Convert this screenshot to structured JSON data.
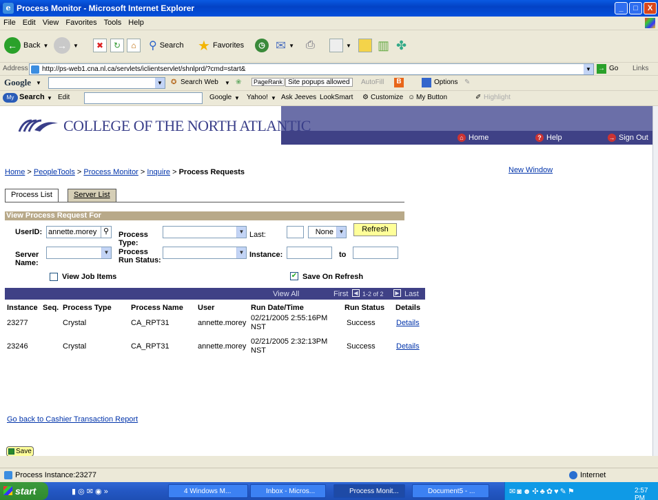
{
  "window": {
    "title": "Process Monitor - Microsoft Internet Explorer",
    "minimize": "_",
    "maximize": "□",
    "close": "X"
  },
  "menu": [
    "File",
    "Edit",
    "View",
    "Favorites",
    "Tools",
    "Help"
  ],
  "toolbar": {
    "back": "Back",
    "search": "Search",
    "favorites": "Favorites"
  },
  "address": {
    "label": "Address",
    "url": "http://ps-web1.cna.nl.ca/servlets/iclientservlet/shnlprd/?cmd=start&",
    "go": "Go",
    "links": "Links"
  },
  "googlebar": {
    "brand": "Google",
    "search_web": "Search Web",
    "pagerank": "PageRank",
    "popups": "Site popups allowed",
    "autofill": "AutoFill",
    "options": "Options"
  },
  "yahoobar": {
    "brand": "Search",
    "edit": "Edit",
    "google": "Google",
    "yahoo": "Yahoo!",
    "askjeeves": "Ask Jeeves",
    "looksmart": "LookSmart",
    "customize": "Customize",
    "mybutton": "My Button",
    "highlight": "Highlight"
  },
  "banner": {
    "college": "COLLEGE OF THE NORTH ATLANTIC",
    "home": "Home",
    "help": "Help",
    "signout": "Sign Out"
  },
  "breadcrumb": {
    "home": "Home",
    "peopletools": "PeopleTools",
    "process_monitor": "Process Monitor",
    "inquire": "Inquire",
    "sep": " > ",
    "current": "Process Requests"
  },
  "new_window": "New Window",
  "tabs": {
    "process_list": "Process List",
    "server_list": "Server List"
  },
  "section_title": "View Process Request For",
  "form": {
    "userid_label": "UserID:",
    "userid_value": "annette.morey",
    "process_type_label": "Process Type:",
    "last_label": "Last:",
    "last_value": "",
    "last_unit": "None",
    "refresh": "Refresh",
    "server_label": "Server Name:",
    "run_status_label": "Process Run Status:",
    "instance_label": "Instance:",
    "instance_from": "",
    "to_label": "to",
    "instance_to": "",
    "view_job_items": "View Job Items",
    "save_on_refresh": "Save On Refresh"
  },
  "grid": {
    "view_all": "View All",
    "first": "First",
    "range": "1-2 of 2",
    "last": "Last",
    "columns": [
      "Instance",
      "Seq.",
      "Process Type",
      "Process Name",
      "User",
      "Run Date/Time",
      "Run Status",
      "Details"
    ],
    "rows": [
      {
        "instance": "23277",
        "seq": "",
        "type": "Crystal",
        "name": "CA_RPT31",
        "user": "annette.morey",
        "date1": "02/21/2005  2:55:16PM",
        "date2": "NST",
        "status": "Success",
        "details": "Details"
      },
      {
        "instance": "23246",
        "seq": "",
        "type": "Crystal",
        "name": "CA_RPT31",
        "user": "annette.morey",
        "date1": "02/21/2005  2:32:13PM",
        "date2": "NST",
        "status": "Success",
        "details": "Details"
      }
    ]
  },
  "back_link": "Go back to Cashier Transaction Report",
  "save": "Save",
  "status": {
    "text": "Process Instance:23277",
    "zone": "Internet"
  },
  "taskbar": {
    "start": "start",
    "tasks": [
      "4 Windows M...",
      "Inbox - Micros...",
      "Process Monit...",
      "Document5 - ..."
    ],
    "clock": "2:57 PM"
  }
}
